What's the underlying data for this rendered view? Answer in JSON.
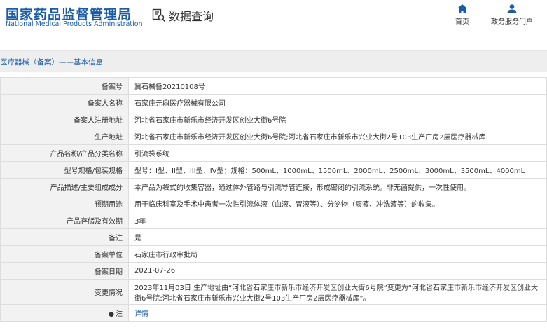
{
  "header": {
    "logo_cn": "国家药品监督管理局",
    "logo_en": "National Medical Products Administration",
    "search_title": "数据查询",
    "nav_home": "首页",
    "nav_portal": "政务服务门户"
  },
  "breadcrumb": "医疗器械（备案）——基本信息",
  "rows": [
    {
      "label": "备案号",
      "value": "冀石械备20210108号"
    },
    {
      "label": "备案人名称",
      "value": "石家庄元鼎医疗器械有限公司"
    },
    {
      "label": "备案人注册地址",
      "value": "河北省石家庄市新乐市经济开发区创业大街6号院"
    },
    {
      "label": "生产地址",
      "value": "河北省石家庄市新乐市经济开发区创业大街6号院;河北省石家庄市新乐市兴业大街2号103生产厂房2层医疗器械库"
    },
    {
      "label": "产品名称/产品分类名称",
      "value": "引流袋系统"
    },
    {
      "label": "型号规格/包装规格",
      "value": "型号：I型、II型、III型、IV型；规格：500mL、1000mL、1500mL、2000mL、2500mL、3000mL、3500mL、4000mL"
    },
    {
      "label": "产品描述/主要组成成分",
      "value": "本产品为袋式的收集容器，通过体外管路与引流导管连接，形成密闭的引流系统。非无菌提供，一次性使用。"
    },
    {
      "label": "预期用途",
      "value": "用于临床科室及手术中患者一次性引流体液（血液、胃液等）、分泌物（痰液、冲洗液等）的收集。"
    },
    {
      "label": "产品存储及有效期",
      "value": "3年"
    },
    {
      "label": "备注",
      "value": "是"
    },
    {
      "label": "备案单位",
      "value": "石家庄市行政审批局"
    },
    {
      "label": "备案日期",
      "value": "2021-07-26"
    },
    {
      "label": "变更情况",
      "value": "2023年11月03日 生产地址由“河北省石家庄市新乐市经济开发区创业大街6号院”变更为“河北省石家庄市新乐市经济开发区创业大街6号院;河北省石家庄市新乐市兴业大街2号103生产厂房2层医疗器械库”。"
    },
    {
      "label": "注",
      "value": "详情"
    }
  ],
  "colors": {
    "brand": "#1a5ca8",
    "label_bg": "#f2f2f2",
    "crumb_bg": "#eeeeee"
  },
  "icons": {
    "search": "data-search-icon",
    "home": "home-icon",
    "user": "user-icon",
    "note": "note-icon"
  }
}
